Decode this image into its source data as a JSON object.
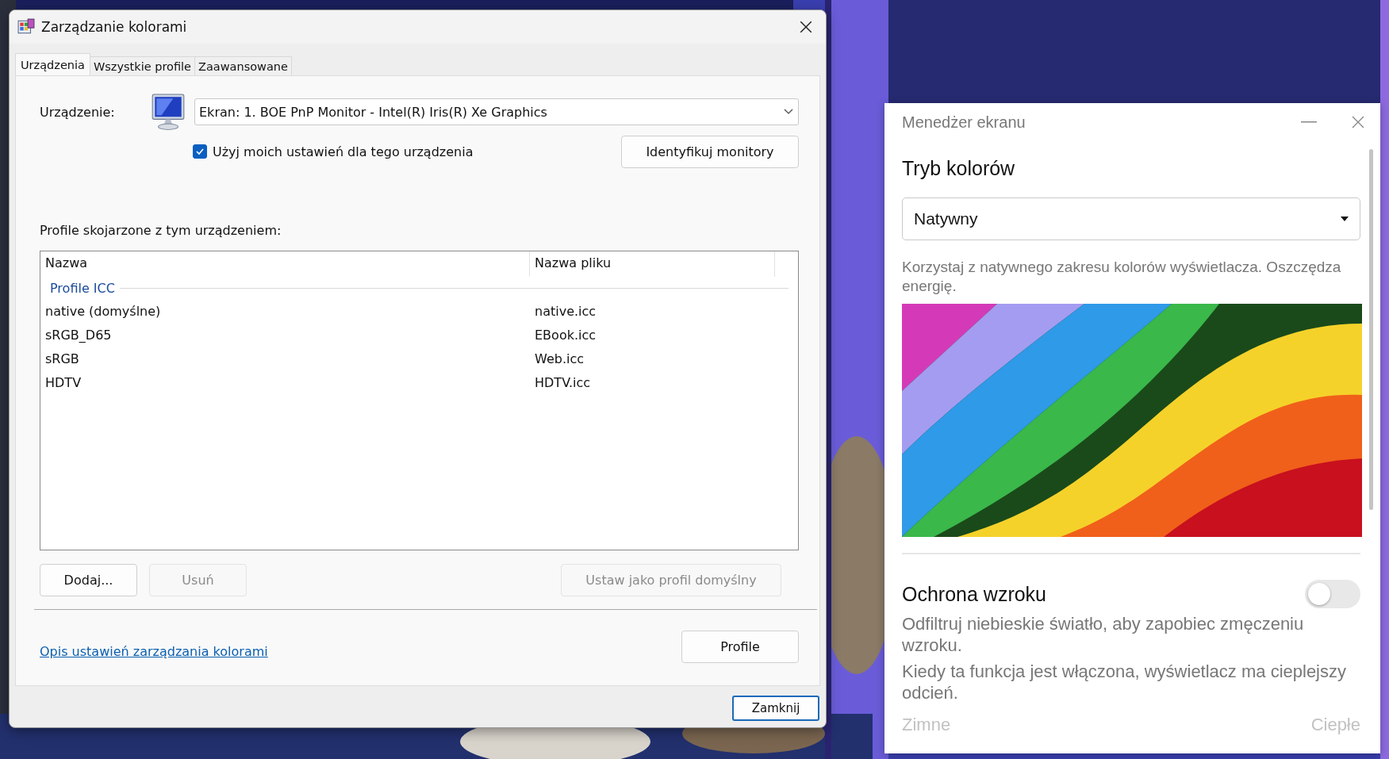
{
  "dialog": {
    "title": "Zarządzanie kolorami",
    "tabs": [
      {
        "label": "Urządzenia",
        "selected": true
      },
      {
        "label": "Wszystkie profile",
        "selected": false
      },
      {
        "label": "Zaawansowane",
        "selected": false
      }
    ],
    "device_label": "Urządzenie:",
    "device_value": "Ekran: 1. BOE PnP Monitor - Intel(R) Iris(R) Xe Graphics",
    "use_my_settings": {
      "label": "Użyj moich ustawień dla tego urządzenia",
      "checked": true
    },
    "identify_button": {
      "label": "Identyfikuj monitory",
      "disabled": false
    },
    "profiles_label": "Profile skojarzone z tym urządzeniem:",
    "table": {
      "columns": [
        "Nazwa",
        "Nazwa pliku"
      ],
      "group": "Profile ICC",
      "rows": [
        {
          "name": "native (domyślne)",
          "file": "native.icc",
          "selected": false
        },
        {
          "name": "sRGB_D65",
          "file": "EBook.icc",
          "selected": false
        },
        {
          "name": "sRGB",
          "file": "Web.icc",
          "selected": false
        },
        {
          "name": "HDTV",
          "file": "HDTV.icc",
          "selected": false
        }
      ]
    },
    "buttons": [
      {
        "label": "Dodaj...",
        "disabled": false
      },
      {
        "label": "Usuń",
        "disabled": true
      },
      {
        "label": "Ustaw jako profil domyślny",
        "disabled": true
      }
    ],
    "link": "Opis ustawień zarządzania kolorami",
    "profile_button": {
      "label": "Profile",
      "disabled": false
    },
    "close_button": {
      "label": "Zamknij",
      "disabled": false
    }
  },
  "display_manager": {
    "title": "Menedżer ekranu",
    "color_mode": {
      "heading": "Tryb kolorów",
      "value": "Natywny",
      "description": "Korzystaj z natywnego zakresu kolorów wyświetlacza. Oszczędza energię."
    },
    "eye_care": {
      "heading": "Ochrona wzroku",
      "on": false,
      "descriptions": [
        "Odfiltruj niebieskie światło, aby zapobiec zmęczeniu wzroku.",
        "Kiedy ta funkcja jest włączona, wyświetlacz ma cieplejszy odcień."
      ],
      "scale_min": "Zimne",
      "scale_max": "Ciepłe"
    }
  }
}
